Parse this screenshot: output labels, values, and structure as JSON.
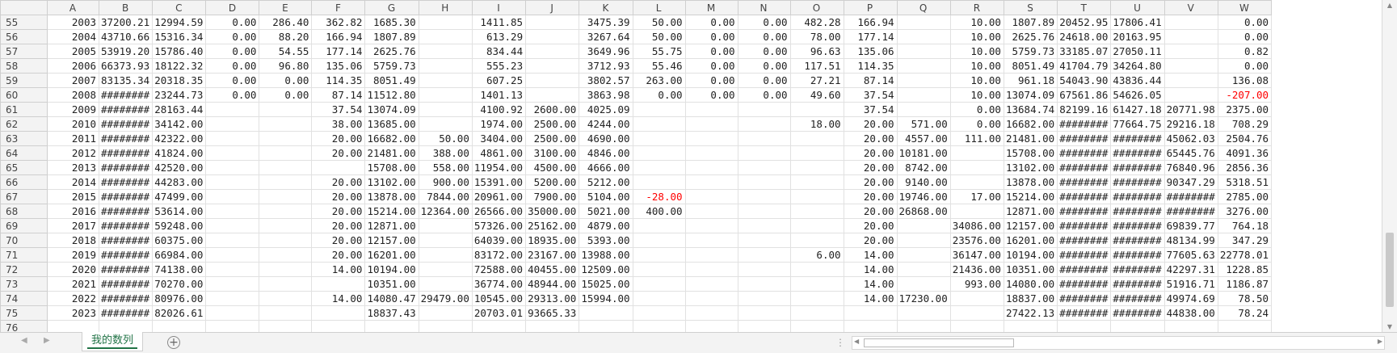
{
  "columns": [
    "A",
    "B",
    "C",
    "D",
    "E",
    "F",
    "G",
    "H",
    "I",
    "J",
    "K",
    "L",
    "M",
    "N",
    "O",
    "P",
    "Q",
    "R",
    "S",
    "T",
    "U",
    "V",
    "W"
  ],
  "rows": [
    {
      "num": "55",
      "cells": [
        "2003",
        "37200.21",
        "12994.59",
        "0.00",
        "286.40",
        "362.82",
        "1685.30",
        "",
        "1411.85",
        "",
        "3475.39",
        "50.00",
        "0.00",
        "0.00",
        "482.28",
        "166.94",
        "",
        "10.00",
        "1807.89",
        "20452.95",
        "17806.41",
        "",
        "0.00"
      ]
    },
    {
      "num": "56",
      "cells": [
        "2004",
        "43710.66",
        "15316.34",
        "0.00",
        "88.20",
        "166.94",
        "1807.89",
        "",
        "613.29",
        "",
        "3267.64",
        "50.00",
        "0.00",
        "0.00",
        "78.00",
        "177.14",
        "",
        "10.00",
        "2625.76",
        "24618.00",
        "20163.95",
        "",
        "0.00"
      ]
    },
    {
      "num": "57",
      "cells": [
        "2005",
        "53919.20",
        "15786.40",
        "0.00",
        "54.55",
        "177.14",
        "2625.76",
        "",
        "834.44",
        "",
        "3649.96",
        "55.75",
        "0.00",
        "0.00",
        "96.63",
        "135.06",
        "",
        "10.00",
        "5759.73",
        "33185.07",
        "27050.11",
        "",
        "0.82"
      ]
    },
    {
      "num": "58",
      "cells": [
        "2006",
        "66373.93",
        "18122.32",
        "0.00",
        "96.80",
        "135.06",
        "5759.73",
        "",
        "555.23",
        "",
        "3712.93",
        "55.46",
        "0.00",
        "0.00",
        "117.51",
        "114.35",
        "",
        "10.00",
        "8051.49",
        "41704.79",
        "34264.80",
        "",
        "0.00"
      ]
    },
    {
      "num": "59",
      "cells": [
        "2007",
        "83135.34",
        "20318.35",
        "0.00",
        "0.00",
        "114.35",
        "8051.49",
        "",
        "607.25",
        "",
        "3802.57",
        "263.00",
        "0.00",
        "0.00",
        "27.21",
        "87.14",
        "",
        "10.00",
        "961.18",
        "54043.90",
        "43836.44",
        "",
        "136.08"
      ]
    },
    {
      "num": "60",
      "cells": [
        "2008",
        "########",
        "23244.73",
        "0.00",
        "0.00",
        "87.14",
        "11512.80",
        "",
        "1401.13",
        "",
        "3863.98",
        "0.00",
        "0.00",
        "0.00",
        "49.60",
        "37.54",
        "",
        "10.00",
        "13074.09",
        "67561.86",
        "54626.05",
        "",
        "-207.00"
      ]
    },
    {
      "num": "61",
      "cells": [
        "2009",
        "########",
        "28163.44",
        "",
        "",
        "37.54",
        "13074.09",
        "",
        "4100.92",
        "2600.00",
        "4025.09",
        "",
        "",
        "",
        "",
        "37.54",
        "",
        "0.00",
        "13684.74",
        "82199.16",
        "61427.18",
        "20771.98",
        "2375.00"
      ]
    },
    {
      "num": "62",
      "cells": [
        "2010",
        "########",
        "34142.00",
        "",
        "",
        "38.00",
        "13685.00",
        "",
        "1974.00",
        "2500.00",
        "4244.00",
        "",
        "",
        "",
        "18.00",
        "20.00",
        "571.00",
        "0.00",
        "16682.00",
        "########",
        "77664.75",
        "29216.18",
        "708.29"
      ]
    },
    {
      "num": "63",
      "cells": [
        "2011",
        "########",
        "42322.00",
        "",
        "",
        "20.00",
        "16682.00",
        "50.00",
        "3404.00",
        "2500.00",
        "4690.00",
        "",
        "",
        "",
        "",
        "20.00",
        "4557.00",
        "111.00",
        "21481.00",
        "########",
        "########",
        "45062.03",
        "2504.76"
      ]
    },
    {
      "num": "64",
      "cells": [
        "2012",
        "########",
        "41824.00",
        "",
        "",
        "20.00",
        "21481.00",
        "388.00",
        "4861.00",
        "3100.00",
        "4846.00",
        "",
        "",
        "",
        "",
        "20.00",
        "10181.00",
        "",
        "15708.00",
        "########",
        "########",
        "65445.76",
        "4091.36"
      ]
    },
    {
      "num": "65",
      "cells": [
        "2013",
        "########",
        "42520.00",
        "",
        "",
        "",
        "15708.00",
        "558.00",
        "11954.00",
        "4500.00",
        "4666.00",
        "",
        "",
        "",
        "",
        "20.00",
        "8742.00",
        "",
        "13102.00",
        "########",
        "########",
        "76840.96",
        "2856.36"
      ]
    },
    {
      "num": "66",
      "cells": [
        "2014",
        "########",
        "44283.00",
        "",
        "",
        "20.00",
        "13102.00",
        "900.00",
        "15391.00",
        "5200.00",
        "5212.00",
        "",
        "",
        "",
        "",
        "20.00",
        "9140.00",
        "",
        "13878.00",
        "########",
        "########",
        "90347.29",
        "5318.51"
      ]
    },
    {
      "num": "67",
      "cells": [
        "2015",
        "########",
        "47499.00",
        "",
        "",
        "20.00",
        "13878.00",
        "7844.00",
        "20961.00",
        "7900.00",
        "5104.00",
        "-28.00",
        "",
        "",
        "",
        "20.00",
        "19746.00",
        "17.00",
        "15214.00",
        "########",
        "########",
        "########",
        "2785.00"
      ]
    },
    {
      "num": "68",
      "cells": [
        "2016",
        "########",
        "53614.00",
        "",
        "",
        "20.00",
        "15214.00",
        "12364.00",
        "26566.00",
        "35000.00",
        "5021.00",
        "400.00",
        "",
        "",
        "",
        "20.00",
        "26868.00",
        "",
        "12871.00",
        "########",
        "########",
        "########",
        "3276.00"
      ]
    },
    {
      "num": "69",
      "cells": [
        "2017",
        "########",
        "59248.00",
        "",
        "",
        "20.00",
        "12871.00",
        "",
        "57326.00",
        "25162.00",
        "4879.00",
        "",
        "",
        "",
        "",
        "20.00",
        "",
        "34086.00",
        "12157.00",
        "########",
        "########",
        "69839.77",
        "764.18"
      ]
    },
    {
      "num": "70",
      "cells": [
        "2018",
        "########",
        "60375.00",
        "",
        "",
        "20.00",
        "12157.00",
        "",
        "64039.00",
        "18935.00",
        "5393.00",
        "",
        "",
        "",
        "",
        "20.00",
        "",
        "23576.00",
        "16201.00",
        "########",
        "########",
        "48134.99",
        "347.29"
      ]
    },
    {
      "num": "71",
      "cells": [
        "2019",
        "########",
        "66984.00",
        "",
        "",
        "20.00",
        "16201.00",
        "",
        "83172.00",
        "23167.00",
        "13988.00",
        "",
        "",
        "",
        "6.00",
        "14.00",
        "",
        "36147.00",
        "10194.00",
        "########",
        "########",
        "77605.63",
        "22778.01"
      ]
    },
    {
      "num": "72",
      "cells": [
        "2020",
        "########",
        "74138.00",
        "",
        "",
        "14.00",
        "10194.00",
        "",
        "72588.00",
        "40455.00",
        "12509.00",
        "",
        "",
        "",
        "",
        "14.00",
        "",
        "21436.00",
        "10351.00",
        "########",
        "########",
        "42297.31",
        "1228.85"
      ]
    },
    {
      "num": "73",
      "cells": [
        "2021",
        "########",
        "70270.00",
        "",
        "",
        "",
        "10351.00",
        "",
        "36774.00",
        "48944.00",
        "15025.00",
        "",
        "",
        "",
        "",
        "14.00",
        "",
        "993.00",
        "14080.00",
        "########",
        "########",
        "51916.71",
        "1186.87"
      ]
    },
    {
      "num": "74",
      "cells": [
        "2022",
        "########",
        "80976.00",
        "",
        "",
        "14.00",
        "14080.47",
        "29479.00",
        "10545.00",
        "29313.00",
        "15994.00",
        "",
        "",
        "",
        "",
        "14.00",
        "17230.00",
        "",
        "18837.00",
        "########",
        "########",
        "49974.69",
        "78.50"
      ]
    },
    {
      "num": "75",
      "cells": [
        "2023",
        "########",
        "82026.61",
        "",
        "",
        "",
        "18837.43",
        "",
        "20703.01",
        "93665.33",
        "",
        "",
        "",
        "",
        "",
        "",
        "",
        "",
        "27422.13",
        "########",
        "########",
        "44838.00",
        "78.24"
      ]
    },
    {
      "num": "76",
      "cells": [
        "",
        "",
        "",
        "",
        "",
        "",
        "",
        "",
        "",
        "",
        "",
        "",
        "",
        "",
        "",
        "",
        "",
        "",
        "",
        "",
        "",
        "",
        ""
      ]
    }
  ],
  "sheet_tab": {
    "label": "我的数列"
  },
  "colors": {
    "accent": "#217346",
    "negative": "#ff0000",
    "header_bg": "#f3f3f3",
    "grid": "#e1e1e1"
  },
  "icons": {
    "add_sheet": "plus-circle-icon",
    "nav_prev": "triangle-left-icon",
    "nav_next": "triangle-right-icon"
  }
}
